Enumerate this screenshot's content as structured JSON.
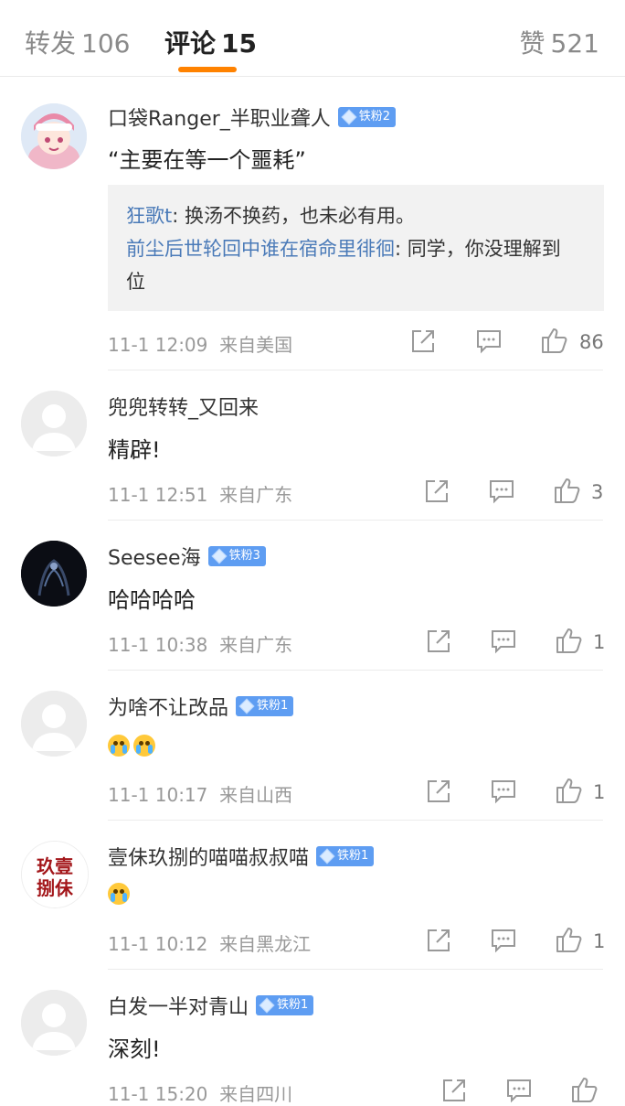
{
  "tabs": {
    "repost_label": "转发",
    "repost_count": "106",
    "comments_label": "评论",
    "comments_count": "15",
    "likes_label": "赞",
    "likes_count": "521"
  },
  "accent_color": "#ff8200",
  "comments": [
    {
      "user": "口袋Ranger_半职业聋人",
      "badge": "铁粉2",
      "text": "“主要在等一个噩耗”",
      "replies": [
        {
          "user": "狂歌t",
          "text": ": 换汤不换药，也未必有用。"
        },
        {
          "user": "前尘后世轮回中谁在宿命里徘徊",
          "text": ": 同学，你没理解到位"
        }
      ],
      "time": "11-1 12:09",
      "location": "来自美国",
      "likes": "86"
    },
    {
      "user": "兜兜转转_又回来",
      "text": "精辟!",
      "time": "11-1 12:51",
      "location": "来自广东",
      "likes": "3"
    },
    {
      "user": "Seesee海",
      "badge": "铁粉3",
      "text": "哈哈哈哈",
      "time": "11-1 10:38",
      "location": "来自广东",
      "likes": "1"
    },
    {
      "user": "为啥不让改品",
      "badge": "铁粉1",
      "text": "",
      "emoji": "crying-face-emoji",
      "time": "11-1 10:17",
      "location": "来自山西",
      "likes": "1"
    },
    {
      "user": "壹佅玖捌的喵喵叔叔喵",
      "badge": "铁粉1",
      "text": "",
      "emoji": "laughing-tears-emoji",
      "avatar_text": "玖壹捌佅",
      "time": "11-1 10:12",
      "location": "来自黑龙江",
      "likes": "1"
    },
    {
      "user": "白发一半对青山",
      "badge": "铁粉1",
      "text": "深刻!",
      "time": "11-1 15:20",
      "location": "来自四川",
      "likes": ""
    }
  ]
}
